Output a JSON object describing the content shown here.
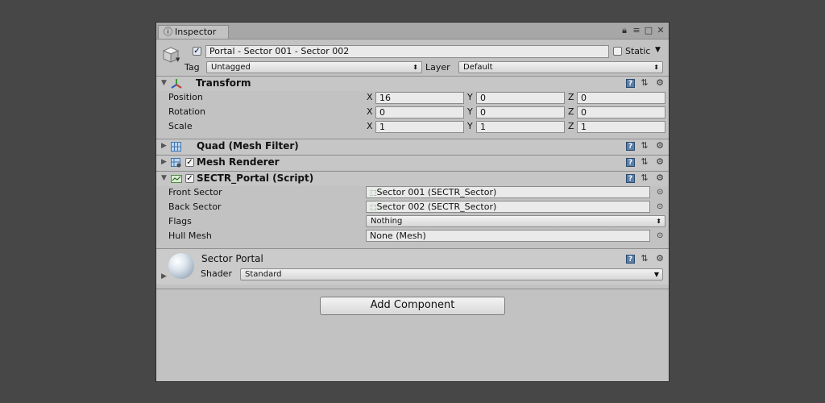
{
  "window": {
    "tab_label": "Inspector",
    "tab_icon": "info-icon",
    "buttons": [
      "lock-icon",
      "menu-icon",
      "maximize-icon",
      "close-icon"
    ]
  },
  "gameobject": {
    "active": true,
    "name": "Portal - Sector 001 - Sector 002",
    "static_label": "Static",
    "static_checked": false,
    "tag_label": "Tag",
    "tag_value": "Untagged",
    "layer_label": "Layer",
    "layer_value": "Default"
  },
  "transform": {
    "title": "Transform",
    "rows": [
      {
        "label": "Position",
        "x": "16",
        "y": "0",
        "z": "0"
      },
      {
        "label": "Rotation",
        "x": "0",
        "y": "0",
        "z": "0"
      },
      {
        "label": "Scale",
        "x": "1",
        "y": "1",
        "z": "1"
      }
    ],
    "axis": {
      "x": "X",
      "y": "Y",
      "z": "Z"
    }
  },
  "mesh_filter": {
    "title": "Quad (Mesh Filter)"
  },
  "mesh_renderer": {
    "title": "Mesh Renderer",
    "enabled": true
  },
  "portal": {
    "title": "SECTR_Portal (Script)",
    "enabled": true,
    "front_label": "Front Sector",
    "front_value": "Sector 001 (SECTR_Sector)",
    "back_label": "Back Sector",
    "back_value": "Sector 002 (SECTR_Sector)",
    "flags_label": "Flags",
    "flags_value": "Nothing",
    "hull_label": "Hull Mesh",
    "hull_value": "None (Mesh)"
  },
  "material": {
    "name": "Sector Portal",
    "shader_label": "Shader",
    "shader_value": "Standard"
  },
  "add_component_label": "Add Component",
  "colors": {
    "panel": "#c2c2c2",
    "background": "#474747",
    "help_blue": "#5a7fa8"
  }
}
